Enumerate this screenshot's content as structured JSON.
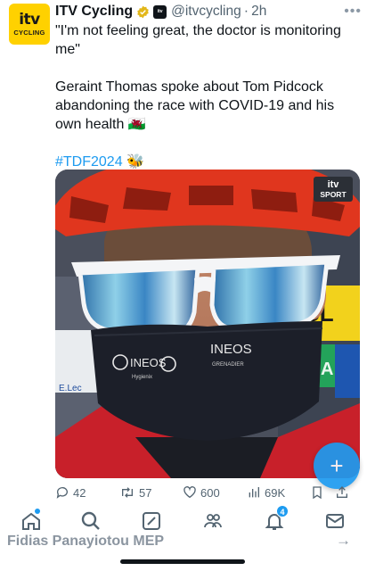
{
  "tweet": {
    "avatar": {
      "logo_top": "itv",
      "logo_bottom": "CYCLING"
    },
    "author_name": "ITV Cycling",
    "handle": "@itvcycling",
    "separator": "·",
    "time": "2h",
    "more_icon": "more-icon",
    "paragraphs": [
      "\"I'm not feeling great, the doctor is monitoring me\"",
      "Geraint Thomas spoke about Tom Pidcock abandoning the race with COVID-19 and his own health 🏴󠁧󠁢󠁷󠁬󠁳󠁿"
    ],
    "hashtag": "#TDF2024",
    "hashtag_emoji": "🐝",
    "media": {
      "badge_line1": "itv",
      "badge_line2": "SPORT",
      "mask_text_left": "INEOS",
      "mask_text_left_small": "Hygienix",
      "mask_text_right": "INEOS",
      "mask_text_right_small": "GRENADIER",
      "bg_sign_1": "CL",
      "bg_sign_2": "ODA",
      "bg_sign_3": "E.Lec"
    },
    "actions": {
      "replies": "42",
      "retweets": "57",
      "likes": "600",
      "views": "69K"
    }
  },
  "fab_icon": "compose-plus-icon",
  "next_item": {
    "title": "Fidias Panayiotou MEP",
    "arrow": "→"
  },
  "nav": {
    "notifications_badge": "4"
  },
  "colors": {
    "accent": "#1d9bf0",
    "itv_yellow": "#ffd100",
    "text": "#0f1419",
    "muted": "#536471"
  }
}
